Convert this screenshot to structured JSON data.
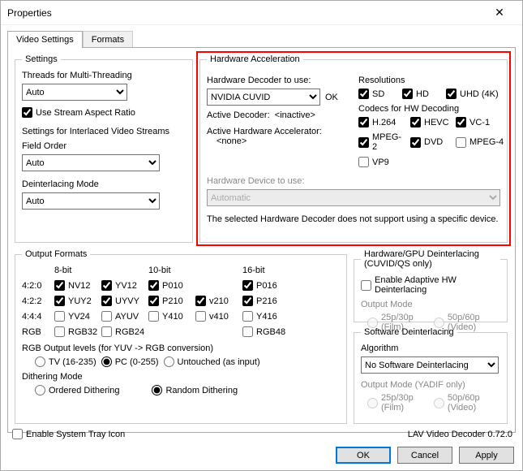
{
  "window": {
    "title": "Properties"
  },
  "tabs": {
    "video": "Video Settings",
    "formats": "Formats"
  },
  "settings": {
    "legend": "Settings",
    "threads_label": "Threads for Multi-Threading",
    "threads_value": "Auto",
    "stream_ar": "Use Stream Aspect Ratio",
    "interlaced_label": "Settings for Interlaced Video Streams",
    "field_order_label": "Field Order",
    "field_order_value": "Auto",
    "deint_mode_label": "Deinterlacing Mode",
    "deint_mode_value": "Auto"
  },
  "hw": {
    "legend": "Hardware Acceleration",
    "decoder_label": "Hardware Decoder to use:",
    "decoder_value": "NVIDIA CUVID",
    "decoder_ok": "OK",
    "active_decoder_label": "Active Decoder:",
    "active_decoder_value": "<inactive>",
    "active_accel_label": "Active Hardware Accelerator:",
    "active_accel_value": "<none>",
    "device_label": "Hardware Device to use:",
    "device_value": "Automatic",
    "warn": "The selected Hardware Decoder does not support using a specific device.",
    "res": {
      "legend": "Resolutions",
      "sd": "SD",
      "hd": "HD",
      "uhd": "UHD (4K)"
    },
    "codecs": {
      "legend": "Codecs for HW Decoding",
      "h264": "H.264",
      "hevc": "HEVC",
      "vc1": "VC-1",
      "mpeg2": "MPEG-2",
      "dvd": "DVD",
      "mpeg4": "MPEG-4",
      "vp9": "VP9"
    }
  },
  "output": {
    "legend": "Output Formats",
    "h8": "8-bit",
    "h10": "10-bit",
    "h16": "16-bit",
    "rows": {
      "420": "4:2:0",
      "422": "4:2:2",
      "444": "4:4:4",
      "rgb": "RGB"
    },
    "fmt": {
      "nv12": "NV12",
      "yv12": "YV12",
      "p010": "P010",
      "p016": "P016",
      "yuy2": "YUY2",
      "uyvy": "UYVY",
      "p210": "P210",
      "v210": "v210",
      "p216": "P216",
      "yv24": "YV24",
      "ayuv": "AYUV",
      "y410": "Y410",
      "v410": "v410",
      "y416": "Y416",
      "rgb32": "RGB32",
      "rgb24": "RGB24",
      "rgb48": "RGB48"
    },
    "rgb_levels_label": "RGB Output levels (for YUV -> RGB conversion)",
    "rgb_tv": "TV (16-235)",
    "rgb_pc": "PC (0-255)",
    "rgb_un": "Untouched (as input)",
    "dither_label": "Dithering Mode",
    "dither_ordered": "Ordered Dithering",
    "dither_random": "Random Dithering"
  },
  "hwdeint": {
    "legend": "Hardware/GPU Deinterlacing (CUVID/QS only)",
    "enable": "Enable Adaptive HW Deinterlacing",
    "output_mode": "Output Mode",
    "film": "25p/30p (Film)",
    "video": "50p/60p (Video)"
  },
  "swdeint": {
    "legend": "Software Deinterlacing",
    "algo_label": "Algorithm",
    "algo_value": "No Software Deinterlacing",
    "output_mode": "Output Mode (YADIF only)",
    "film": "25p/30p (Film)",
    "video": "50p/60p (Video)"
  },
  "footer": {
    "tray": "Enable System Tray Icon",
    "status": "LAV Video Decoder 0.72.0",
    "ok": "OK",
    "cancel": "Cancel",
    "apply": "Apply"
  }
}
